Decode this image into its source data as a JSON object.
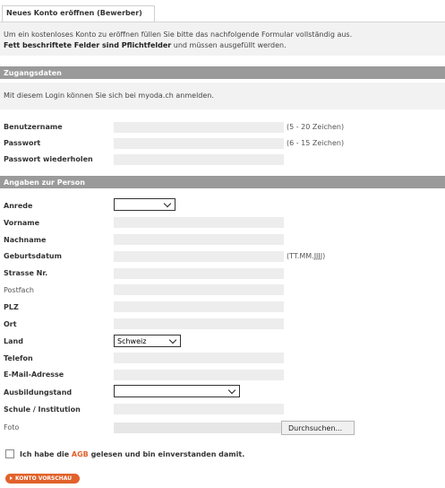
{
  "tab": {
    "label": "Neues Konto eröffnen (Bewerber)"
  },
  "intro": {
    "line1": "Um ein kostenloses Konto zu eröffnen füllen Sie bitte das nachfolgende Formular vollständig aus.",
    "line2_bold": "Fett beschriftete Felder sind Pflichtfelder",
    "line2_rest": " und müssen ausgefüllt werden."
  },
  "access": {
    "header": "Zugangsdaten",
    "info": "Mit diesem Login können Sie sich bei myoda.ch anmelden.",
    "fields": {
      "username": {
        "label": "Benutzername",
        "value": "",
        "hint": "(5 - 20 Zeichen)"
      },
      "password": {
        "label": "Passwort",
        "value": "",
        "hint": "(6 - 15 Zeichen)"
      },
      "password_repeat": {
        "label": "Passwort wiederholen",
        "value": ""
      }
    }
  },
  "person": {
    "header": "Angaben zur Person",
    "fields": {
      "salutation": {
        "label": "Anrede",
        "value": ""
      },
      "firstname": {
        "label": "Vorname",
        "value": ""
      },
      "lastname": {
        "label": "Nachname",
        "value": ""
      },
      "birthdate": {
        "label": "Geburtsdatum",
        "value": "",
        "hint": "(TT.MM.JJJJ)"
      },
      "street": {
        "label": "Strasse Nr.",
        "value": ""
      },
      "pobox": {
        "label": "Postfach",
        "value": ""
      },
      "zip": {
        "label": "PLZ",
        "value": ""
      },
      "city": {
        "label": "Ort",
        "value": ""
      },
      "country": {
        "label": "Land",
        "value": "Schweiz"
      },
      "phone": {
        "label": "Telefon",
        "value": ""
      },
      "email": {
        "label": "E-Mail-Adresse",
        "value": ""
      },
      "education": {
        "label": "Ausbildungstand",
        "value": ""
      },
      "school": {
        "label": "Schule / Institution",
        "value": ""
      },
      "photo": {
        "label": "Foto",
        "button": "Durchsuchen..."
      }
    }
  },
  "agb": {
    "before": "Ich habe die ",
    "link": "AGB",
    "after": " gelesen und bin einverstanden damit."
  },
  "submit": {
    "label": "KONTO VORSCHAU"
  },
  "colors": {
    "accent": "#e2622b",
    "section_bar": "#9a9a9a",
    "field_bg": "#ededed"
  }
}
